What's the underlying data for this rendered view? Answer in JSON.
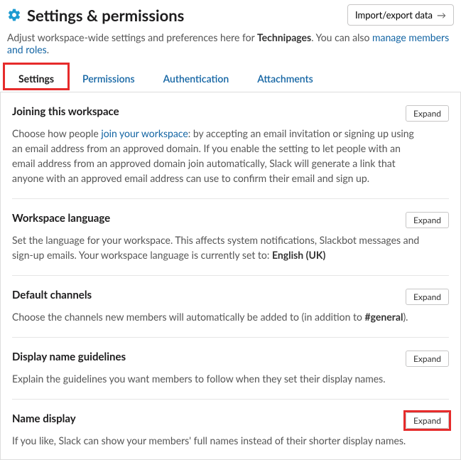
{
  "header": {
    "title": "Settings & permissions",
    "importExportLabel": "Import/export data"
  },
  "subheader": {
    "pre": "Adjust workspace-wide settings and preferences here for ",
    "workspaceName": "Technipages",
    "mid": ". You can also ",
    "manageLink": "manage members and roles",
    "post": "."
  },
  "tabs": [
    {
      "label": "Settings",
      "active": true,
      "highlighted": true
    },
    {
      "label": "Permissions",
      "active": false,
      "highlighted": false
    },
    {
      "label": "Authentication",
      "active": false,
      "highlighted": false
    },
    {
      "label": "Attachments",
      "active": false,
      "highlighted": false
    }
  ],
  "expandLabel": "Expand",
  "sections": {
    "joining": {
      "title": "Joining this workspace",
      "desc_pre": "Choose how people ",
      "desc_link": "join your workspace",
      "desc_post": ": by accepting an email invitation or signing up using an email address from an approved domain. If you enable the setting to let people with an email address from an approved domain join automatically, Slack will generate a link that anyone with an approved email address can use to confirm their email and sign up."
    },
    "language": {
      "title": "Workspace language",
      "desc_pre": "Set the language for your workspace. This affects system notifications, Slackbot messages and sign-up emails. Your workspace language is currently set to: ",
      "desc_bold": "English (UK)",
      "desc_post": ""
    },
    "defaultChannels": {
      "title": "Default channels",
      "desc_pre": "Choose the channels new members will automatically be added to (in addition to ",
      "desc_bold": "#general",
      "desc_post": ")."
    },
    "displayGuidelines": {
      "title": "Display name guidelines",
      "desc": "Explain the guidelines you want members to follow when they set their display names."
    },
    "nameDisplay": {
      "title": "Name display",
      "desc": "If you like, Slack can show your members' full names instead of their shorter display names.",
      "expandHighlighted": true
    }
  }
}
